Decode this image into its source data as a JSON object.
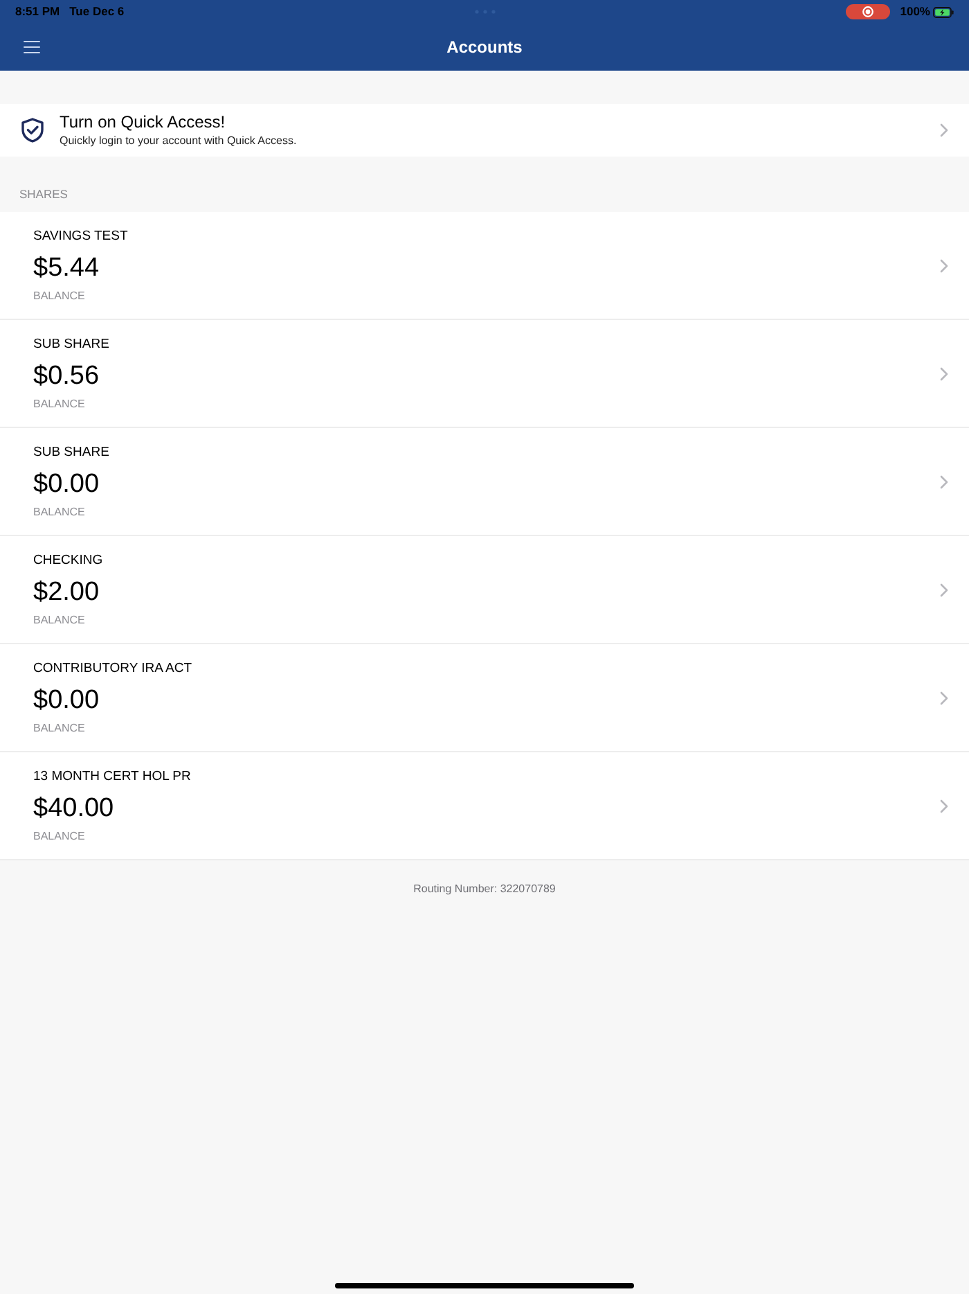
{
  "status_bar": {
    "time": "8:51 PM",
    "date": "Tue Dec 6",
    "battery": "100%"
  },
  "header": {
    "title": "Accounts"
  },
  "quick_access": {
    "title": "Turn on Quick Access!",
    "subtitle": "Quickly login to your account with Quick Access."
  },
  "section": {
    "title": "SHARES",
    "accounts": [
      {
        "name": "SAVINGS TEST",
        "amount": "$5.44",
        "label": "BALANCE"
      },
      {
        "name": "SUB SHARE",
        "amount": "$0.56",
        "label": "BALANCE"
      },
      {
        "name": "SUB SHARE",
        "amount": "$0.00",
        "label": "BALANCE"
      },
      {
        "name": "CHECKING",
        "amount": "$2.00",
        "label": "BALANCE"
      },
      {
        "name": "CONTRIBUTORY IRA ACT",
        "amount": "$0.00",
        "label": "BALANCE"
      },
      {
        "name": "13 MONTH CERT HOL PR",
        "amount": "$40.00",
        "label": "BALANCE"
      }
    ]
  },
  "footer": {
    "routing": "Routing Number: 322070789"
  }
}
